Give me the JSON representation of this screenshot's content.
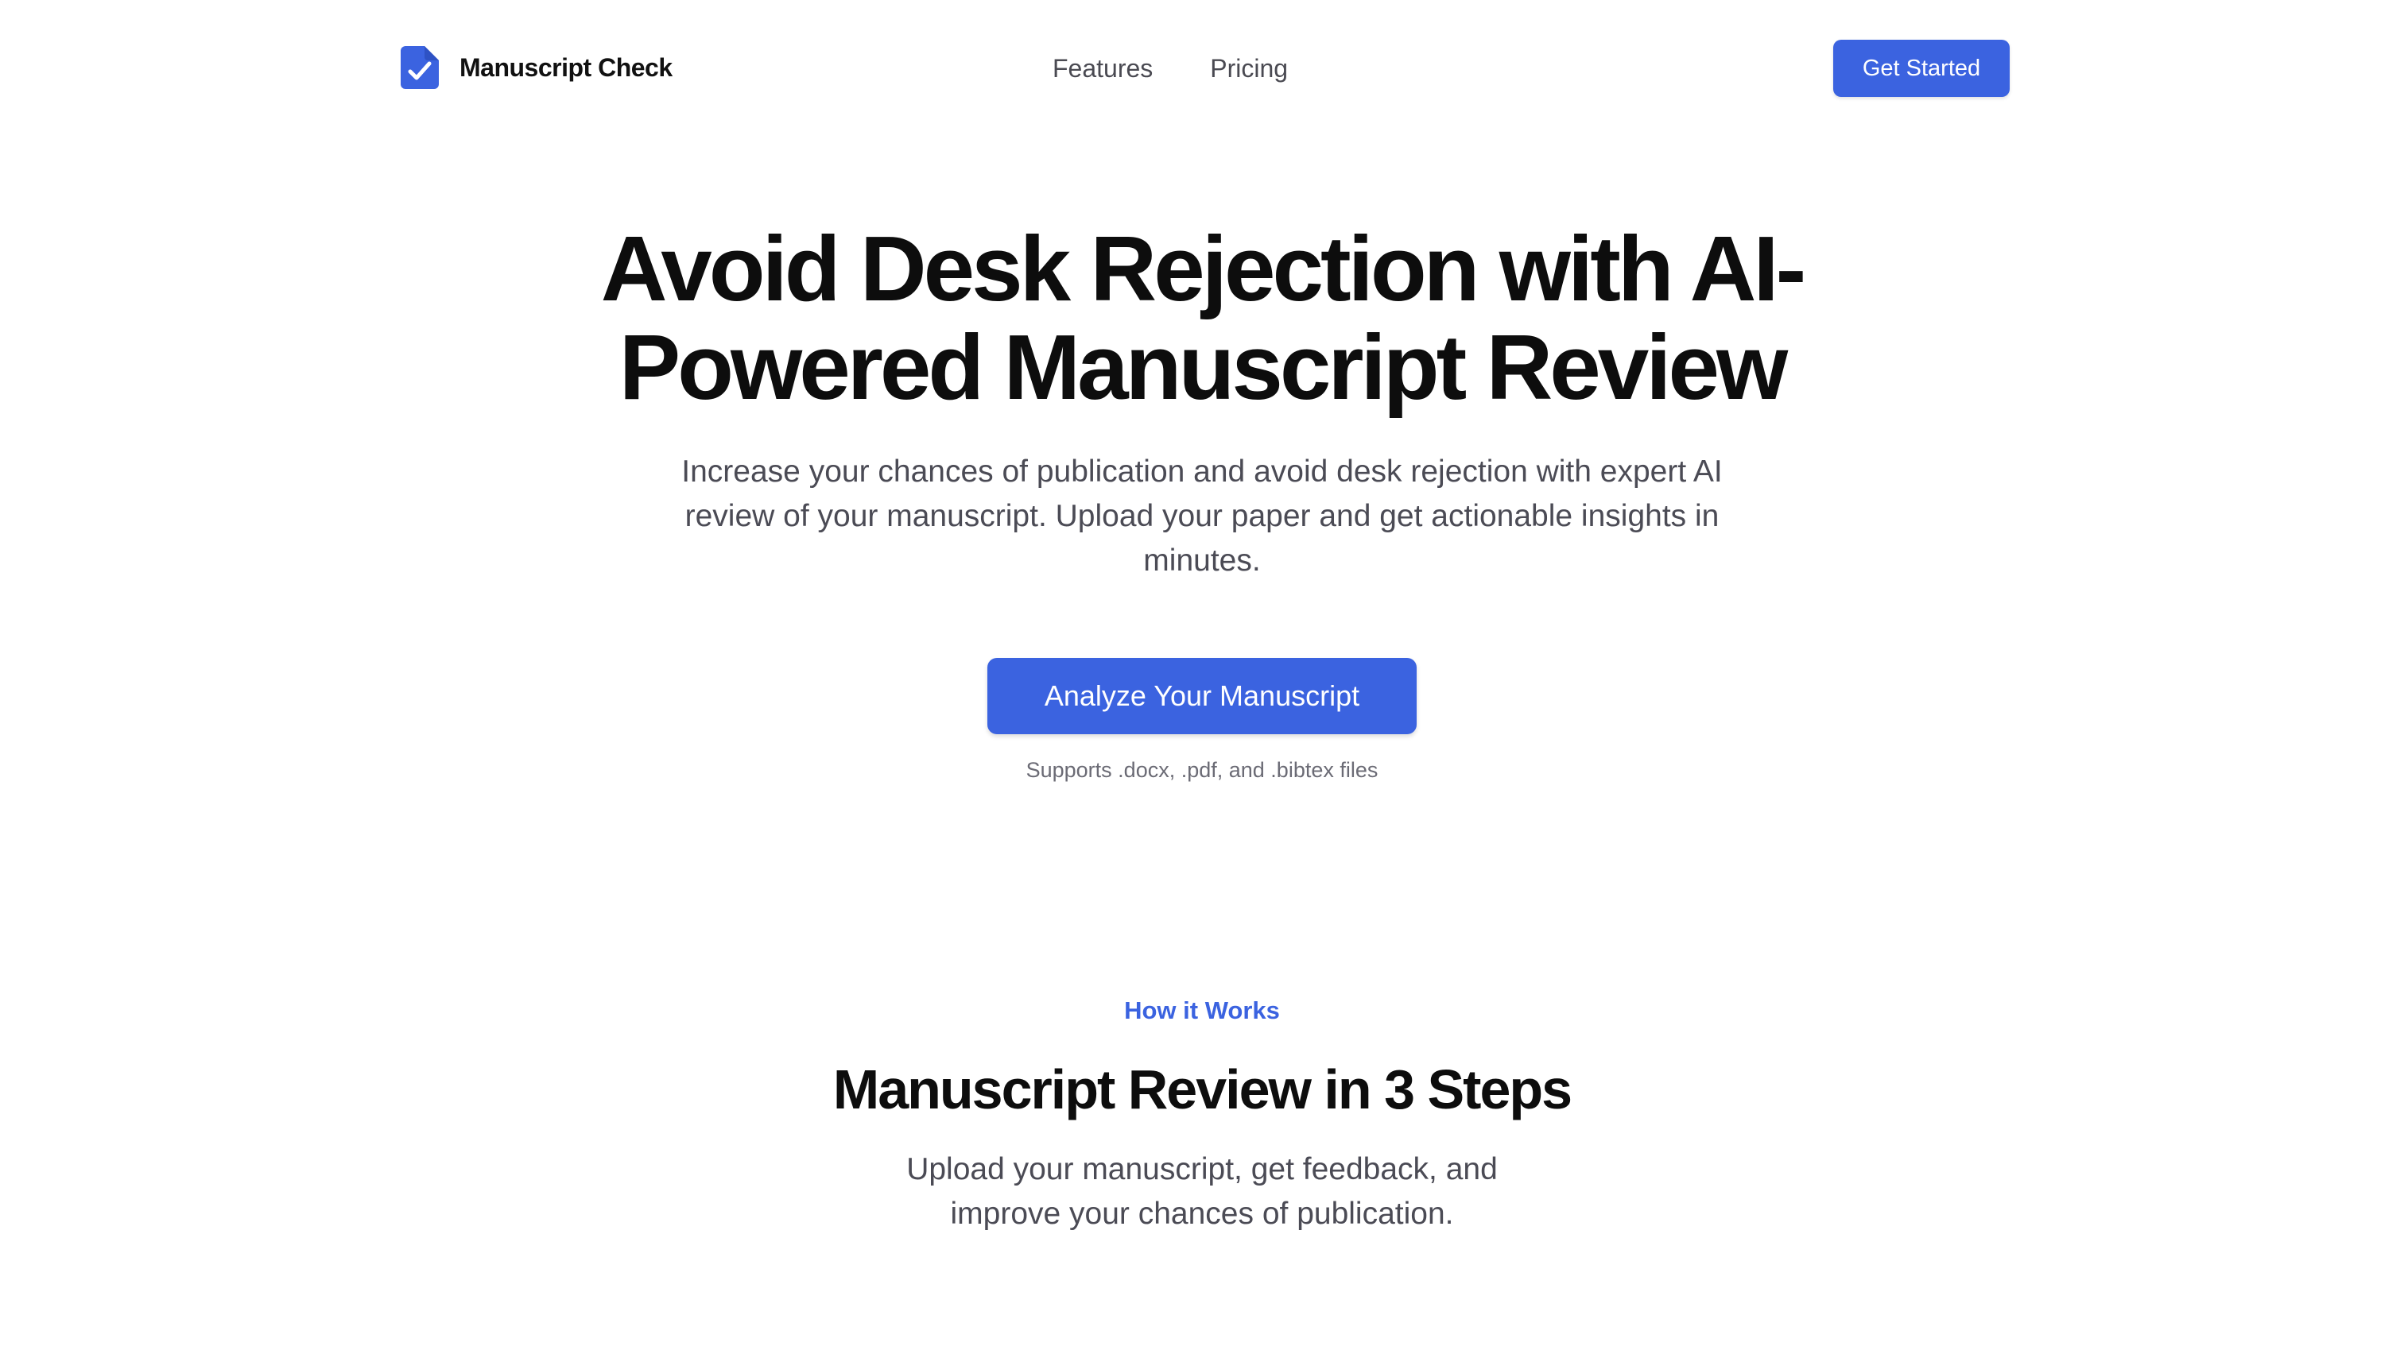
{
  "header": {
    "brand": "Manuscript Check",
    "nav": [
      {
        "label": "Features"
      },
      {
        "label": "Pricing"
      }
    ],
    "cta_label": "Get Started"
  },
  "hero": {
    "title": "Avoid Desk Rejection with AI-Powered Manuscript Review",
    "subtitle": "Increase your chances of publication and avoid desk rejection with expert AI review of your manuscript. Upload your paper and get actionable insights in minutes.",
    "cta_label": "Analyze Your Manuscript",
    "supports_note": "Supports .docx, .pdf, and .bibtex files"
  },
  "how_it_works": {
    "eyebrow": "How it Works",
    "title": "Manuscript Review in 3 Steps",
    "subtitle": "Upload your manuscript, get feedback, and improve your chances of publication."
  },
  "colors": {
    "accent": "#3b63e0",
    "heading": "#0d0d0d",
    "body_text": "#4b4b55",
    "muted_text": "#6b6b75",
    "background": "#ffffff"
  },
  "icons": {
    "logo": "document-check-icon"
  }
}
